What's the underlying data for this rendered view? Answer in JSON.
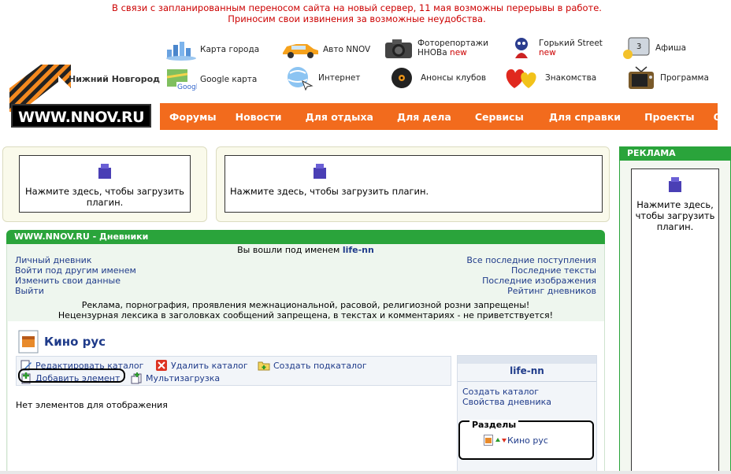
{
  "header": {
    "notice_line1": "В связи с запланированным переносом сайта на новый сервер, 11 мая возможны перерывы в работе.",
    "notice_line2": "Приносим свои извинения за возможные неудобства.",
    "logo_text": "WWW.NNOV.RU",
    "city": "Нижний Новгород",
    "quick_links": [
      {
        "label": "Карта города",
        "icon": "city-map-icon"
      },
      {
        "label": "Авто NNOV",
        "icon": "car-icon"
      },
      {
        "label": "Фоторепортажи",
        "label2": "ННОВа",
        "badge": "new",
        "icon": "camera-icon"
      },
      {
        "label": "Горький Street",
        "badge": "new",
        "icon": "street-icon"
      },
      {
        "label": "Афиша",
        "icon": "poster-icon"
      },
      {
        "label": "Google карта",
        "icon": "google-map-icon"
      },
      {
        "label": "Интернет",
        "icon": "internet-icon"
      },
      {
        "label": "Анонсы клубов",
        "icon": "vinyl-icon"
      },
      {
        "label": "Знакомства",
        "icon": "hearts-icon"
      },
      {
        "label": "Программа",
        "icon": "tv-icon"
      }
    ],
    "nav": [
      "Форумы",
      "Новости",
      "Для отдыха",
      "Для дела",
      "Сервисы",
      "Для справки",
      "Проекты",
      "О сайте"
    ]
  },
  "plugins": {
    "text1": "Нажмите здесь, чтобы загрузить",
    "text2": "плагин.",
    "text_full": "Нажмите здесь, чтобы загрузить плагин.",
    "ad_line1": "Нажмите здесь,",
    "ad_line2": "чтобы загрузить",
    "ad_line3": "плагин."
  },
  "ad": {
    "title": "РЕКЛАМА"
  },
  "diary": {
    "title": "WWW.NNOV.RU - Дневники",
    "logged_as": "Вы вошли под именем",
    "username": "life-nn",
    "left_links": [
      "Личный дневник",
      "Войти под другим именем",
      "Изменить свои данные",
      "Выйти"
    ],
    "right_links": [
      "Все последние поступления",
      "Последние тексты",
      "Последние изображения",
      "Рейтинг дневников"
    ],
    "rule1": "Реклама, порнография, проявления межнациональной, расовой, религиозной розни запрещены!",
    "rule2": "Нецензурная лексика в заголовках сообщений запрещена, в текстах и комментариях - не приветствуется!",
    "catalog_title": "Кино рус",
    "toolbar": {
      "edit": "Редактировать каталог",
      "delete": "Удалить каталог",
      "create_sub": "Создать подкаталог",
      "add": "Добавить элемент",
      "multi": "Мультизагрузка"
    },
    "empty": "Нет элементов для отображения",
    "side": {
      "user": "life-nn",
      "create": "Создать каталог",
      "props": "Свойства дневника",
      "sections_title": "Разделы",
      "section_item": "Кино рус"
    }
  },
  "colors": {
    "nav_bg": "#f26b1d",
    "green": "#2aa43b",
    "notice": "#cc0000",
    "link": "#1f3b8a"
  }
}
